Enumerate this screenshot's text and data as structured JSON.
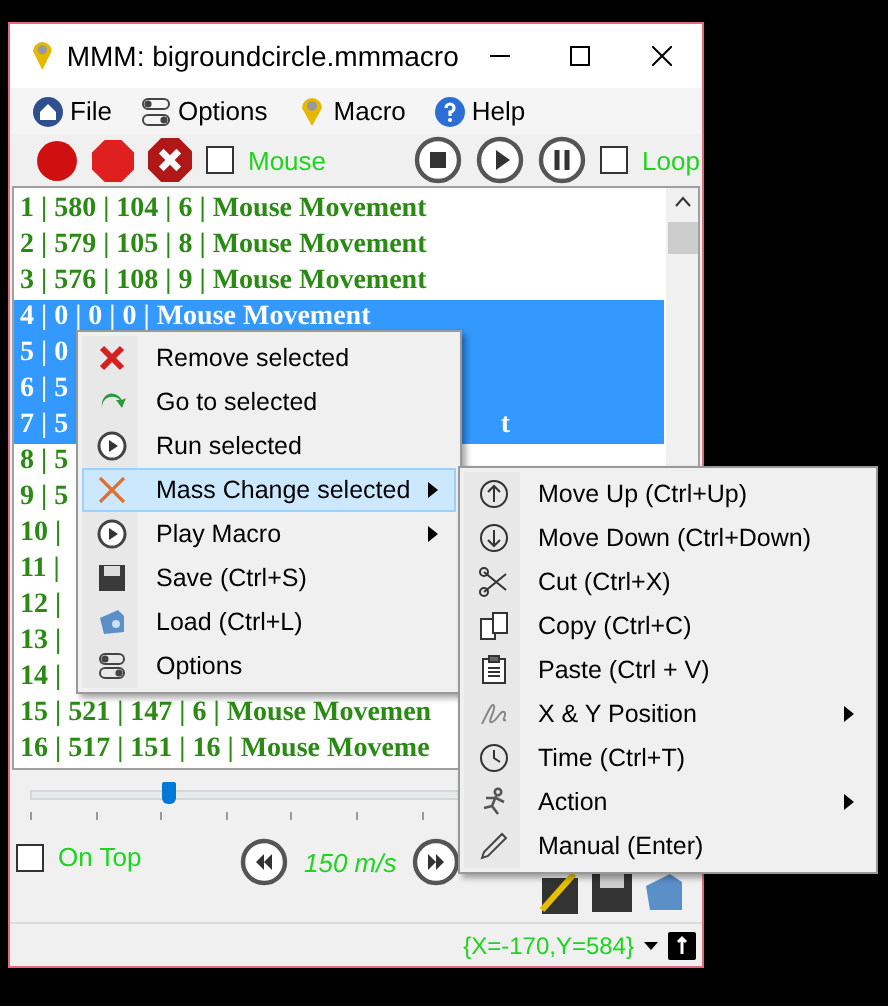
{
  "window": {
    "title": "MMM: bigroundcircle.mmmacro"
  },
  "menu_bar": [
    {
      "label": "File"
    },
    {
      "label": "Options"
    },
    {
      "label": "Macro"
    },
    {
      "label": "Help"
    }
  ],
  "toolbar": {
    "mouse": {
      "label": "Mouse",
      "checked": false
    },
    "loop": {
      "label": "Loop",
      "checked": false
    }
  },
  "macro_list": {
    "rows": [
      {
        "text": "1 | 580 | 104 | 6 | Mouse Movement",
        "selected": false
      },
      {
        "text": "2 | 579 | 105 | 8 | Mouse Movement",
        "selected": false
      },
      {
        "text": "3 | 576 | 108 | 9 | Mouse Movement",
        "selected": false
      },
      {
        "text": "4 | 0 | 0 | 0 | Mouse Movement",
        "selected": true
      },
      {
        "text": "5 | 0",
        "selected": true
      },
      {
        "text": "6 | 5",
        "selected": true
      },
      {
        "text": "7 | 5",
        "tail": "t",
        "selected": true
      },
      {
        "text": "8 | 5",
        "selected": false
      },
      {
        "text": "9 | 5",
        "selected": false
      },
      {
        "text": "10 |",
        "selected": false
      },
      {
        "text": "11 |",
        "selected": false
      },
      {
        "text": "12 |",
        "selected": false
      },
      {
        "text": "13 |",
        "selected": false
      },
      {
        "text": "14 |",
        "selected": false
      },
      {
        "text": "15 | 521 | 147 | 6 | Mouse Movemen",
        "selected": false
      },
      {
        "text": "16 | 517 | 151 | 16 | Mouse Moveme",
        "selected": false
      }
    ]
  },
  "speed_slider": {
    "level": 0.21
  },
  "on_top": {
    "label": "On Top",
    "checked": false
  },
  "speed": "150 m/s",
  "status_bar": {
    "coordinates": "{X=-170,Y=584}"
  },
  "context_menu": {
    "items": [
      {
        "label": "Remove selected",
        "submenu": false,
        "selected": false
      },
      {
        "label": "Go to selected",
        "submenu": false,
        "selected": false
      },
      {
        "label": "Run selected",
        "submenu": false,
        "selected": false
      },
      {
        "label": "Mass Change selected",
        "submenu": true,
        "selected": true
      },
      {
        "label": "Play Macro",
        "submenu": true,
        "selected": false
      },
      {
        "label": "Save (Ctrl+S)",
        "submenu": false,
        "selected": false
      },
      {
        "label": "Load (Ctrl+L)",
        "submenu": false,
        "selected": false
      },
      {
        "label": "Options",
        "submenu": false,
        "selected": false
      }
    ]
  },
  "submenu": {
    "items": [
      {
        "label": "Move Up (Ctrl+Up)",
        "submenu": false,
        "selected": false
      },
      {
        "label": "Move Down (Ctrl+Down)",
        "submenu": false,
        "selected": false
      },
      {
        "label": "Cut (Ctrl+X)",
        "submenu": false,
        "selected": false
      },
      {
        "label": "Copy (Ctrl+C)",
        "submenu": false,
        "selected": false
      },
      {
        "label": "Paste (Ctrl + V)",
        "submenu": false,
        "selected": false
      },
      {
        "label": "X & Y Position",
        "submenu": true,
        "selected": false
      },
      {
        "label": "Time (Ctrl+T)",
        "submenu": false,
        "selected": false
      },
      {
        "label": "Action",
        "submenu": true,
        "selected": false
      },
      {
        "label": "Manual (Enter)",
        "submenu": false,
        "selected": false
      }
    ]
  }
}
